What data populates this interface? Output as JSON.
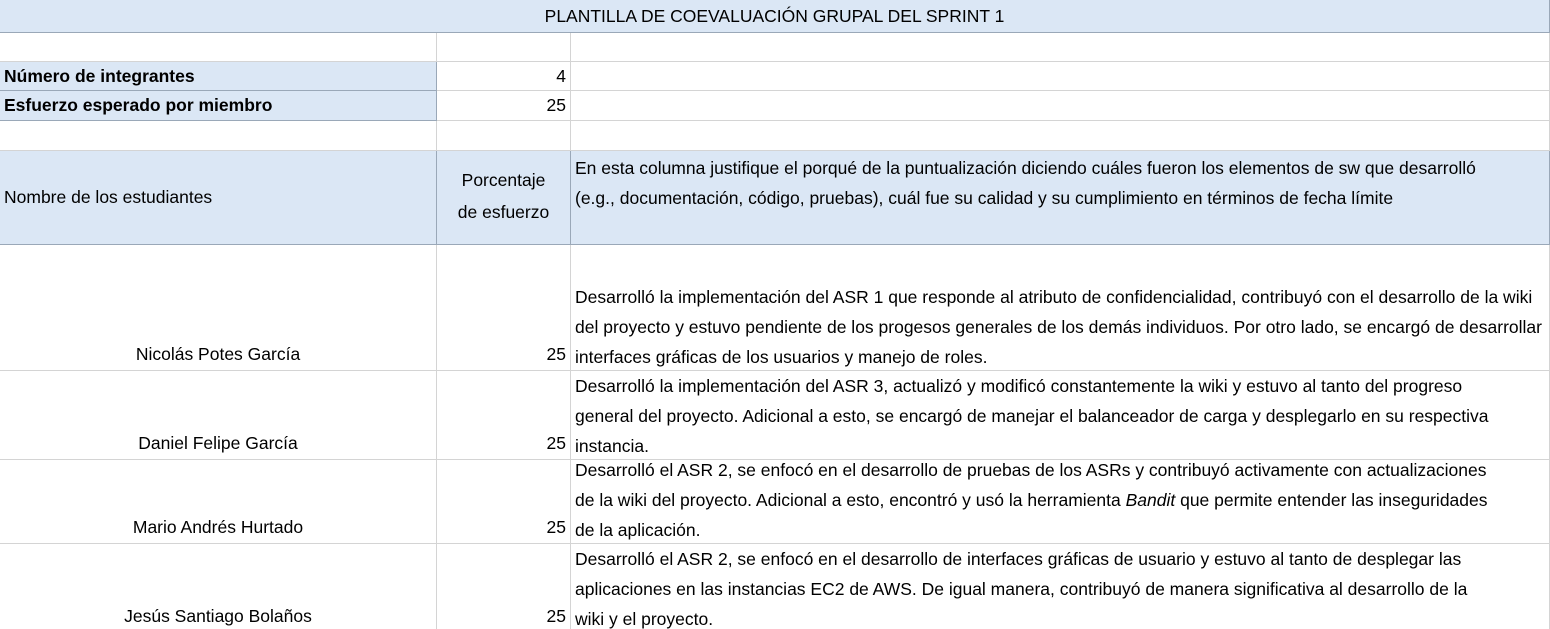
{
  "sheet": {
    "title": "PLANTILLA DE COEVALUACIÓN GRUPAL DEL SPRINT 1",
    "summary": [
      {
        "label": "Número de integrantes",
        "value": "4"
      },
      {
        "label": "Esfuerzo esperado por miembro",
        "value": "25"
      }
    ],
    "table_headers": {
      "name": "Nombre de los estudiantes",
      "percent_line1": "Porcentaje",
      "percent_line2": "de esfuerzo",
      "justification": "En esta columna justifique el porqué de la puntualización diciendo cuáles fueron los elementos de sw que desarrolló (e.g., documentación, código, pruebas), cuál fue su calidad y su cumplimiento en términos de fecha límite"
    },
    "students": [
      {
        "name": "Nicolás Potes García",
        "percent": "25",
        "justification": "Desarrolló la implementación del ASR 1 que responde al atributo de confidencialidad, contribuyó con el desarrollo de la wiki del proyecto y estuvo pendiente de los progesos generales de los demás individuos. Por otro lado, se encargó de desarrollar interfaces gráficas de los usuarios y manejo de roles."
      },
      {
        "name": "Daniel Felipe García",
        "percent": "25",
        "justification": "Desarrolló la implementación del ASR 3, actualizó y modificó constantemente la wiki y estuvo al tanto del progreso general del proyecto. Adicional a esto, se encargó de manejar el balanceador de carga y desplegarlo en su respectiva instancia."
      },
      {
        "name": "Mario Andrés Hurtado",
        "percent": "25",
        "justification_before": "Desarrolló el ASR 2, se enfocó en el desarrollo de pruebas de los ASRs y contribuyó activamente con actualizaciones de la wiki del proyecto. Adicional a esto, encontró y usó la herramienta ",
        "justification_tool": "Bandit",
        "justification_after": "  que permite entender las inseguridades de la aplicación."
      },
      {
        "name": "Jesús Santiago Bolaños",
        "percent": "25",
        "justification": "Desarrolló el ASR 2, se enfocó en el desarrollo de interfaces gráficas de usuario y estuvo al tanto de desplegar las aplicaciones en las instancias EC2 de AWS. De igual manera, contribuyó de manera significativa al desarrollo de la wiki y el proyecto."
      }
    ]
  }
}
